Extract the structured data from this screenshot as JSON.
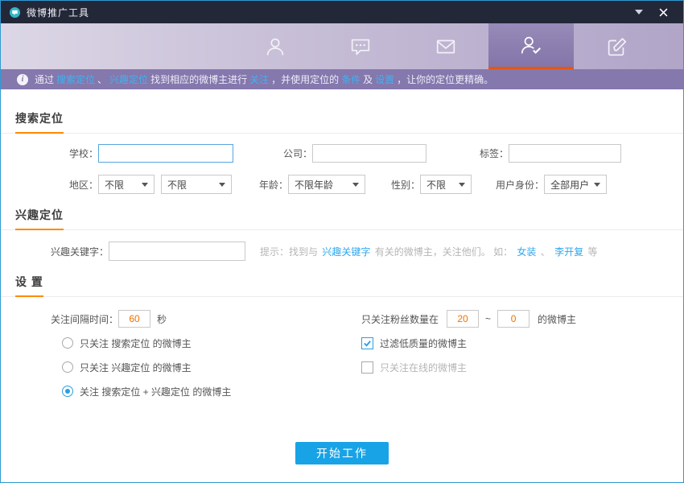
{
  "titlebar": {
    "title": "微博推广工具"
  },
  "toolbar": {
    "tabs": [
      {
        "icon": "user-profile-icon",
        "selected": false
      },
      {
        "icon": "comments-icon",
        "selected": false
      },
      {
        "icon": "mail-icon",
        "selected": false
      },
      {
        "icon": "follow-user-icon",
        "selected": true
      },
      {
        "icon": "compose-icon",
        "selected": false
      }
    ]
  },
  "infobar": {
    "prefix": "通过",
    "link_search": "搜索定位",
    "sep1": "、",
    "link_interest": "兴趣定位",
    "mid1": "找到相应的微博主进行",
    "link_follow": "关注",
    "mid2": "，并使用定位的",
    "link_condition": "条件",
    "mid3": "及",
    "link_setting": "设置",
    "suffix": "，让你的定位更精确。"
  },
  "search_section": {
    "title": "搜索定位",
    "school_label": "学校：",
    "school_value": "",
    "company_label": "公司：",
    "company_value": "",
    "tag_label": "标签：",
    "tag_value": "",
    "region_label": "地区：",
    "region_province_value": "不限",
    "region_city_value": "不限",
    "age_label": "年龄：",
    "age_value": "不限年龄",
    "gender_label": "性别：",
    "gender_value": "不限",
    "identity_label": "用户身份：",
    "identity_value": "全部用户"
  },
  "interest_section": {
    "title": "兴趣定位",
    "keyword_label": "兴趣关键字：",
    "keyword_value": "",
    "hint_prefix": "提示：找到与",
    "hint_link_keyword": "兴趣关键字",
    "hint_mid": "有关的微博主，关注他们。  如：",
    "hint_link_example1": "女装",
    "hint_sep": "、",
    "hint_link_example2": "李开复",
    "hint_suffix": "等"
  },
  "settings_section": {
    "title": "设 置",
    "interval_label": "关注间隔时间：",
    "interval_value": "60",
    "interval_unit": "秒",
    "radio_search_only": "只关注 搜索定位 的微博主",
    "radio_interest_only": "只关注 兴趣定位 的微博主",
    "radio_both": "关注 搜索定位 + 兴趣定位 的微博主",
    "selected_radio": "radio_both",
    "fans_label": "只关注粉丝数量在",
    "fans_min_value": "20",
    "fans_range_separator": "~",
    "fans_max_value": "0",
    "fans_suffix": "的微博主",
    "checkbox_filter_low_quality": "过滤低质量的微博主",
    "checkbox_filter_low_quality_checked": true,
    "checkbox_online_only": "只关注在线的微博主",
    "checkbox_online_only_checked": false
  },
  "footer": {
    "start_button_label": "开始工作"
  },
  "colors": {
    "titlebar_bg": "#232838",
    "toolbar_selected_bg": "#8375a8",
    "tab_underline_orange": "#e8560e",
    "infobar_bg": "#8478ad",
    "link_blue": "#2ea7ef",
    "section_underline_orange": "#ff8a00",
    "value_orange": "#f07000",
    "primary_button_blue": "#18a3e6"
  }
}
